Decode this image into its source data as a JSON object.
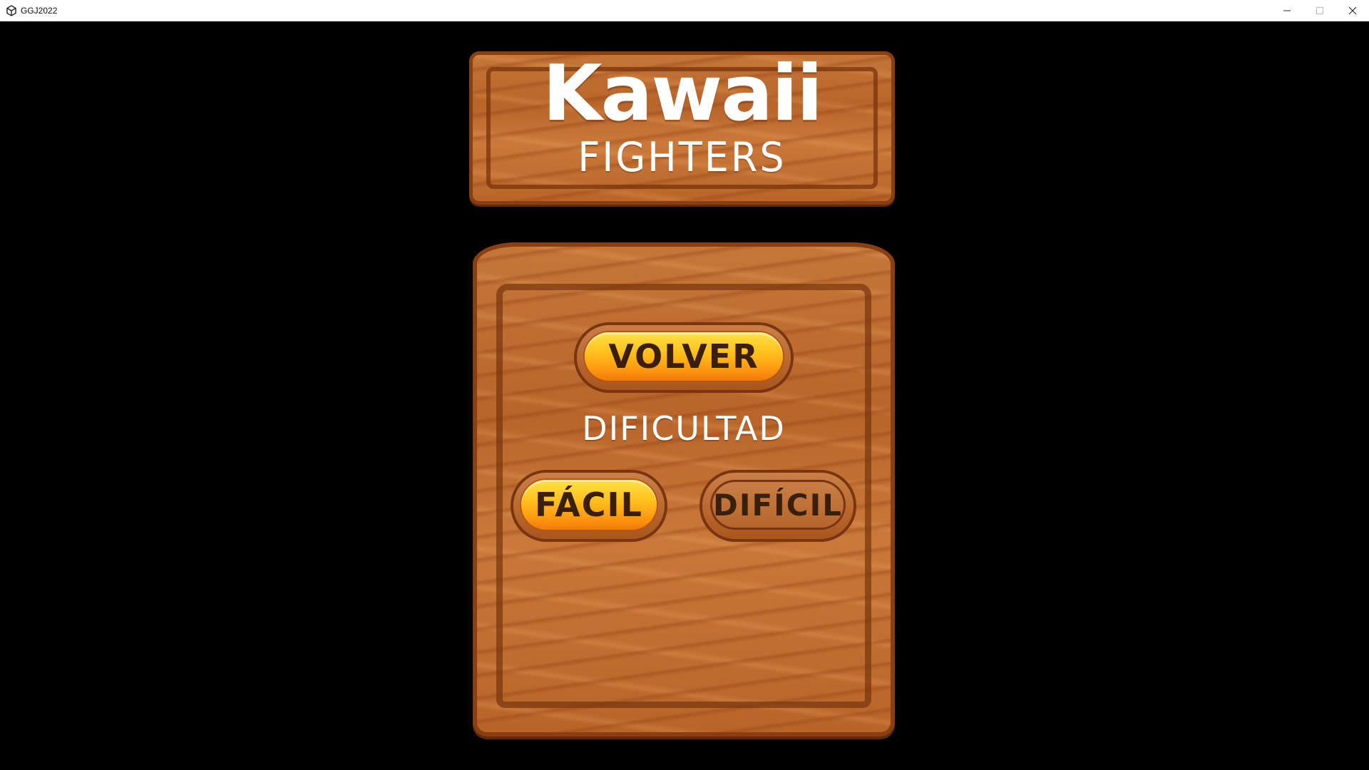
{
  "window": {
    "title": "GGJ2022",
    "app_icon": "unity-icon",
    "controls": {
      "minimize_icon": "minimize-icon",
      "maximize_icon": "maximize-icon",
      "close_icon": "close-icon"
    }
  },
  "logo": {
    "line1": "Kawaii",
    "line2": "FIGHTERS"
  },
  "menu": {
    "back_label": "VOLVER",
    "difficulty_label": "DIFICULTAD",
    "easy_label": "FÁCIL",
    "hard_label": "DIFÍCIL",
    "selected_difficulty": "FÁCIL"
  },
  "colors": {
    "background": "#000000",
    "wood": "#c0702f",
    "wood_dark": "#8a3f12",
    "button_active": "#ffb81e",
    "button_text": "#3a1f0c",
    "label_text": "#ffffff"
  }
}
